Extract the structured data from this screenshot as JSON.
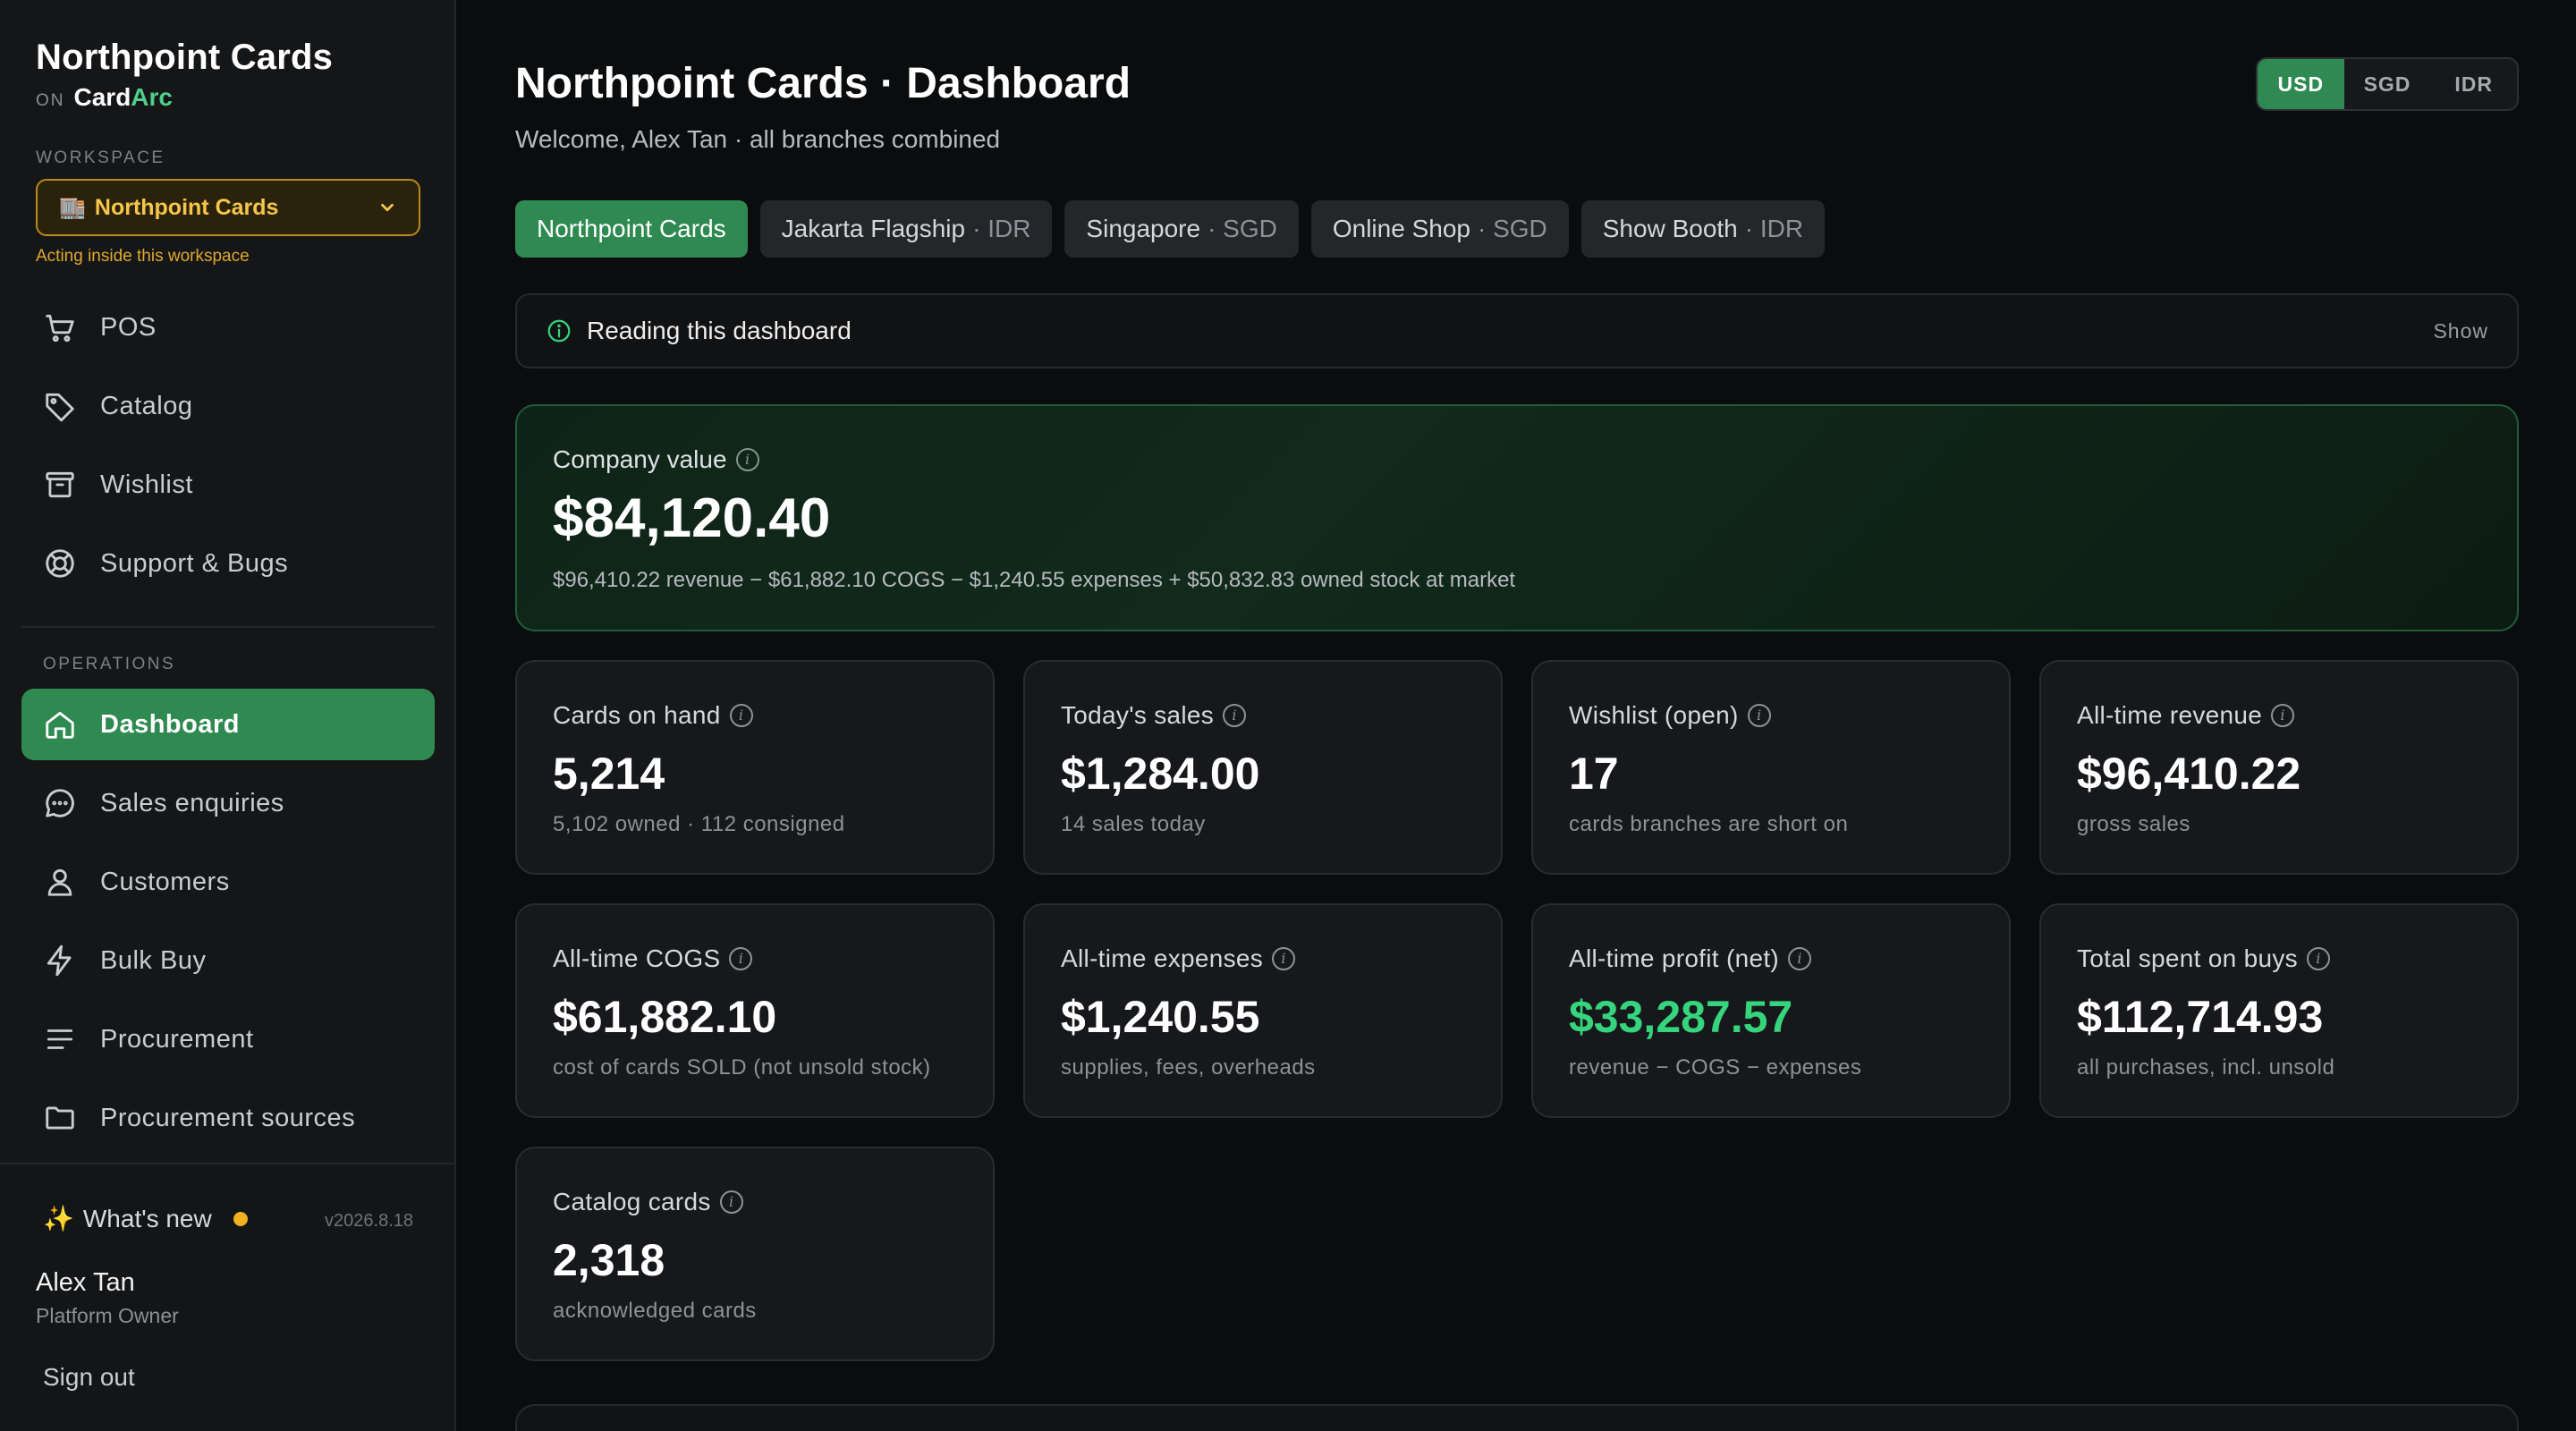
{
  "sidebar": {
    "brand": "Northpoint Cards",
    "brand_on": "ON",
    "brand_platform_a": "Card",
    "brand_platform_b": "Arc",
    "workspace_label": "WORKSPACE",
    "workspace_selected": "Northpoint Cards",
    "workspace_note": "Acting inside this workspace",
    "top_items": [
      {
        "label": "POS",
        "icon": "cart-icon"
      },
      {
        "label": "Catalog",
        "icon": "tag-icon"
      },
      {
        "label": "Wishlist",
        "icon": "archive-icon"
      },
      {
        "label": "Support & Bugs",
        "icon": "lifebuoy-icon"
      }
    ],
    "operations_label": "OPERATIONS",
    "ops_items": [
      {
        "label": "Dashboard",
        "icon": "home-icon",
        "active": true
      },
      {
        "label": "Sales enquiries",
        "icon": "chat-icon"
      },
      {
        "label": "Customers",
        "icon": "user-icon"
      },
      {
        "label": "Bulk Buy",
        "icon": "bolt-icon"
      },
      {
        "label": "Procurement",
        "icon": "list-icon"
      },
      {
        "label": "Procurement sources",
        "icon": "folder-icon"
      }
    ],
    "whats_new": "What's new",
    "version": "v2026.8.18",
    "user_name": "Alex Tan",
    "user_role": "Platform Owner",
    "sign_out": "Sign out"
  },
  "header": {
    "title": "Northpoint Cards · Dashboard",
    "subtitle": "Welcome, Alex Tan · all branches combined",
    "currencies": [
      "USD",
      "SGD",
      "IDR"
    ],
    "active_currency": "USD"
  },
  "branches": [
    {
      "name": "Northpoint Cards",
      "cur": "",
      "active": true
    },
    {
      "name": "Jakarta Flagship",
      "cur": "· IDR"
    },
    {
      "name": "Singapore",
      "cur": "· SGD"
    },
    {
      "name": "Online Shop",
      "cur": "· SGD"
    },
    {
      "name": "Show Booth",
      "cur": "· IDR"
    }
  ],
  "reading": {
    "title": "Reading this dashboard",
    "toggle": "Show"
  },
  "company": {
    "label": "Company value",
    "value": "$84,120.40",
    "breakdown": "$96,410.22 revenue − $61,882.10 COGS − $1,240.55 expenses + $50,832.83 owned stock at market"
  },
  "kpis": [
    {
      "label": "Cards on hand",
      "value": "5,214",
      "sub": "5,102 owned · 112 consigned"
    },
    {
      "label": "Today's sales",
      "value": "$1,284.00",
      "sub": "14 sales today"
    },
    {
      "label": "Wishlist (open)",
      "value": "17",
      "sub": "cards branches are short on"
    },
    {
      "label": "All-time revenue",
      "value": "$96,410.22",
      "sub": "gross sales"
    },
    {
      "label": "All-time COGS",
      "value": "$61,882.10",
      "sub": "cost of cards SOLD (not unsold stock)"
    },
    {
      "label": "All-time expenses",
      "value": "$1,240.55",
      "sub": "supplies, fees, overheads"
    },
    {
      "label": "All-time profit (net)",
      "value": "$33,287.57",
      "sub": "revenue − COGS − expenses",
      "highlight": true
    },
    {
      "label": "Total spent on buys",
      "value": "$112,714.93",
      "sub": "all purchases, incl. unsold"
    },
    {
      "label": "Catalog cards",
      "value": "2,318",
      "sub": "acknowledged cards"
    }
  ],
  "colors": {
    "accent": "#2f8a52",
    "profit": "#36d47c",
    "workspace": "#f5c64a"
  }
}
